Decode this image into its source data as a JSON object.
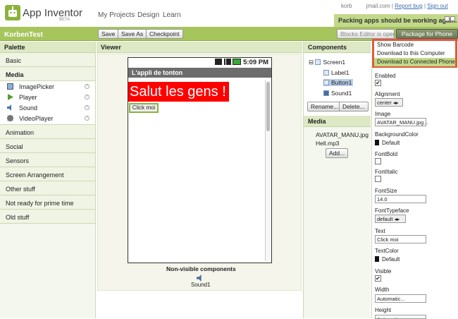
{
  "app": {
    "title": "App Inventor",
    "beta": "BETA"
  },
  "nav": {
    "my_projects": "My Projects",
    "design": "Design",
    "learn": "Learn"
  },
  "top_links": {
    "user": "korb",
    "domain": "jmail.com",
    "sep1": "|",
    "report_bug": "Report bug",
    "sep2": "|",
    "sign_out": "Sign out"
  },
  "notice": "Packing apps should be working again.",
  "project": {
    "name": "KorbenTest",
    "save": "Save",
    "save_as": "Save As",
    "checkpoint": "Checkpoint",
    "blocks_editor": "Blocks Editor is open",
    "package": "Package for Phone ▾"
  },
  "package_menu": [
    "Show Barcode",
    "Download to this Computer",
    "Download to Connected Phone"
  ],
  "palette": {
    "title": "Palette",
    "categories_top": [
      "Basic",
      "Media"
    ],
    "media_items": [
      "ImagePicker",
      "Player",
      "Sound",
      "VideoPlayer"
    ],
    "categories_bottom": [
      "Animation",
      "Social",
      "Sensors",
      "Screen Arrangement",
      "Other stuff",
      "Not ready for prime time",
      "Old stuff"
    ]
  },
  "viewer": {
    "title": "Viewer",
    "time": "5:09 PM",
    "screen_title": "L'appli de tonton",
    "label_text": "Salut les gens !",
    "button_text": "Click moi",
    "nonvisible_title": "Non-visible components",
    "nonvisible_item": "Sound1"
  },
  "components": {
    "title": "Components",
    "screen": "Screen1",
    "items": [
      "Label1",
      "Button1",
      "Sound1"
    ],
    "rename": "Rename...",
    "delete": "Delete...",
    "media_title": "Media",
    "media_items": [
      "AVATAR_MANU.jpg",
      "Hell.mp3"
    ],
    "add": "Add..."
  },
  "properties": {
    "enabled": "Enabled",
    "alignment": "Alignment",
    "alignment_value": "center ◂▸",
    "image": "Image",
    "image_value": "AVATAR_MANU.jpg...",
    "bgcolor": "BackgroundColor",
    "bgcolor_value": "Default",
    "fontbold": "FontBold",
    "fontitalic": "FontItalic",
    "fontsize": "FontSize",
    "fontsize_value": "14.0",
    "fonttypeface": "FontTypeface",
    "fonttypeface_value": "default ◂▸",
    "text": "Text",
    "text_value": "Click moi",
    "textcolor": "TextColor",
    "textcolor_value": "Default",
    "visible": "Visible",
    "width": "Width",
    "width_value": "Automatic...",
    "height": "Height",
    "height_value": "Automatic...",
    "check": "✔"
  }
}
